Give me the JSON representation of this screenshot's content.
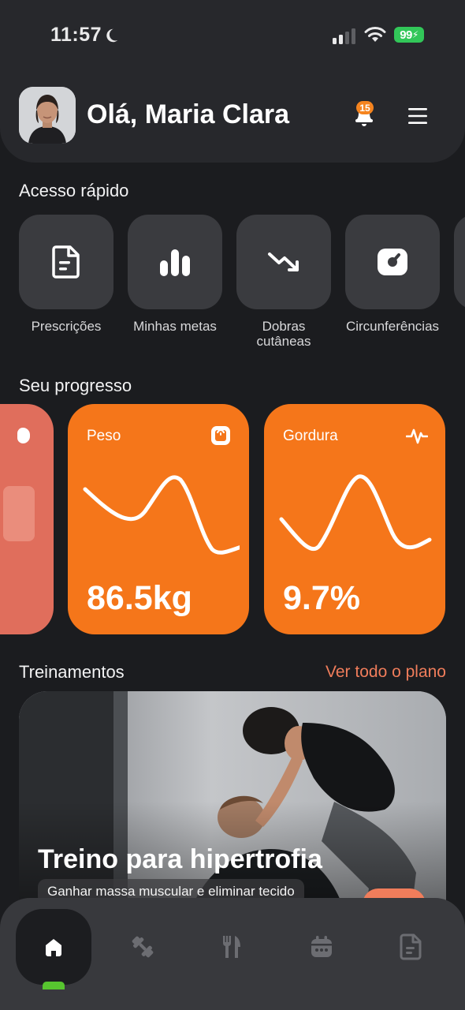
{
  "status_bar": {
    "time": "11:57",
    "battery": "99",
    "moon_icon": "moon-icon",
    "signal_icon": "cellular-signal-icon",
    "wifi_icon": "wifi-icon"
  },
  "header": {
    "greeting": "Olá, Maria Clara",
    "notification_count": "15",
    "bell_icon": "bell-icon",
    "menu_icon": "hamburger-menu-icon"
  },
  "quick_access": {
    "title": "Acesso rápido",
    "items": [
      {
        "label": "Prescrições",
        "icon": "document-icon"
      },
      {
        "label": "Minhas metas",
        "icon": "bar-chart-icon"
      },
      {
        "label": "Dobras cutâneas",
        "icon": "trend-down-icon"
      },
      {
        "label": "Circunferências",
        "icon": "gauge-icon"
      }
    ]
  },
  "progress": {
    "title": "Seu progresso",
    "cards": [
      {
        "title": "Peso",
        "value": "86.5kg",
        "icon": "scale-icon"
      },
      {
        "title": "Gordura",
        "value": "9.7%",
        "icon": "activity-pulse-icon"
      }
    ]
  },
  "trainings": {
    "title": "Treinamentos",
    "see_all": "Ver todo o plano",
    "card": {
      "title": "Treino para hipertrofia",
      "subtitle": "Ganhar massa muscular e eliminar tecido"
    }
  },
  "bottom_nav": {
    "items": [
      {
        "icon": "home-icon",
        "active": true
      },
      {
        "icon": "dumbbell-icon",
        "active": false
      },
      {
        "icon": "fork-knife-icon",
        "active": false
      },
      {
        "icon": "calendar-icon",
        "active": false
      },
      {
        "icon": "document-icon",
        "active": false
      }
    ]
  },
  "colors": {
    "background": "#1b1c1f",
    "card": "#27282c",
    "tile": "#3a3b3f",
    "accent_orange": "#f5761a",
    "link": "#f07d5b",
    "nav_indicator": "#57c42f"
  }
}
